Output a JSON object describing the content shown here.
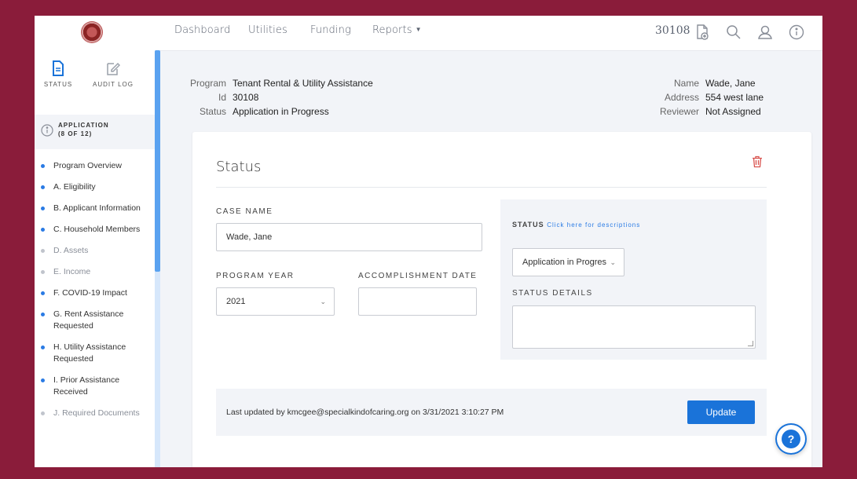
{
  "nav": {
    "items": [
      "Dashboard",
      "Utilities",
      "Funding",
      "Reports"
    ],
    "record_id": "30108"
  },
  "sidebar": {
    "tabs": {
      "status": "STATUS",
      "audit": "AUDIT LOG"
    },
    "app_label_line1": "APPLICATION",
    "app_label_line2": "(8 OF 12)",
    "items": [
      {
        "label": "Program Overview",
        "active": true
      },
      {
        "label": "A. Eligibility",
        "active": true
      },
      {
        "label": "B. Applicant Information",
        "active": true
      },
      {
        "label": "C. Household Members",
        "active": true
      },
      {
        "label": "D. Assets",
        "active": false
      },
      {
        "label": "E. Income",
        "active": false
      },
      {
        "label": "F. COVID-19 Impact",
        "active": true
      },
      {
        "label": "G. Rent Assistance Requested",
        "active": true
      },
      {
        "label": "H. Utility Assistance Requested",
        "active": true
      },
      {
        "label": "I. Prior Assistance Received",
        "active": true
      },
      {
        "label": "J. Required Documents",
        "active": false
      }
    ]
  },
  "header": {
    "program_key": "Program",
    "program_val": "Tenant Rental & Utility Assistance",
    "id_key": "Id",
    "id_val": "30108",
    "status_key": "Status",
    "status_val": "Application in Progress",
    "name_key": "Name",
    "name_val": "Wade, Jane",
    "address_key": "Address",
    "address_val": "554 west lane",
    "reviewer_key": "Reviewer",
    "reviewer_val": "Not Assigned"
  },
  "card": {
    "title": "Status",
    "case_name_label": "CASE NAME",
    "case_name_value": "Wade, Jane",
    "program_year_label": "PROGRAM YEAR",
    "program_year_value": "2021",
    "accomplishment_label": "ACCOMPLISHMENT DATE",
    "accomplishment_value": "",
    "status_label": "STATUS",
    "status_link": "Click here for descriptions",
    "status_value": "Application in Progres",
    "status_details_label": "STATUS DETAILS",
    "status_details_value": "",
    "footer_text": "Last updated by kmcgee@specialkindofcaring.org on 3/31/2021 3:10:27 PM",
    "update_button": "Update"
  },
  "help": {
    "label": "?"
  },
  "colors": {
    "accent": "#1a73d9",
    "frame": "#8a1c3a",
    "trash": "#d9534f"
  }
}
